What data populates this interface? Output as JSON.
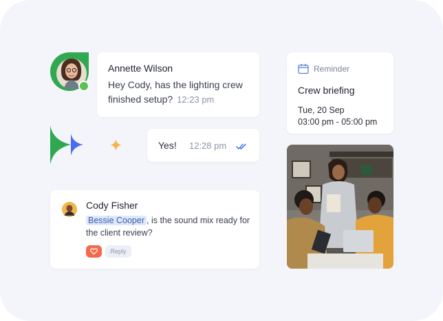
{
  "message_1": {
    "author": "Annette Wilson",
    "text": "Hey Cody, has the lighting crew finished setup?",
    "time": "12:23 pm",
    "avatar_icon": "person-avatar",
    "status_color": "#5ac251"
  },
  "message_2": {
    "text": "Yes!",
    "time": "12:28 pm",
    "status_icon": "double-check-icon",
    "status_color": "#4a7cf0"
  },
  "reminder": {
    "label": "Reminder",
    "icon": "calendar-icon",
    "title": "Crew briefing",
    "date": "Tue, 20 Sep",
    "time_range": "03:00 pm - 05:00 pm"
  },
  "comment": {
    "author": "Cody Fisher",
    "mention": "Bessie Cooper",
    "text": ", is the sound mix ready for the client review?",
    "reaction_icon": "heart-icon",
    "reaction_color": "#f26a4b",
    "reply_label": "Reply"
  },
  "decor": {
    "accent_green": "#2fa84f",
    "accent_blue": "#4a6cf0",
    "sparkle_color": "#f7b24a"
  },
  "photo": {
    "subject": "team-at-laptop-photo"
  }
}
